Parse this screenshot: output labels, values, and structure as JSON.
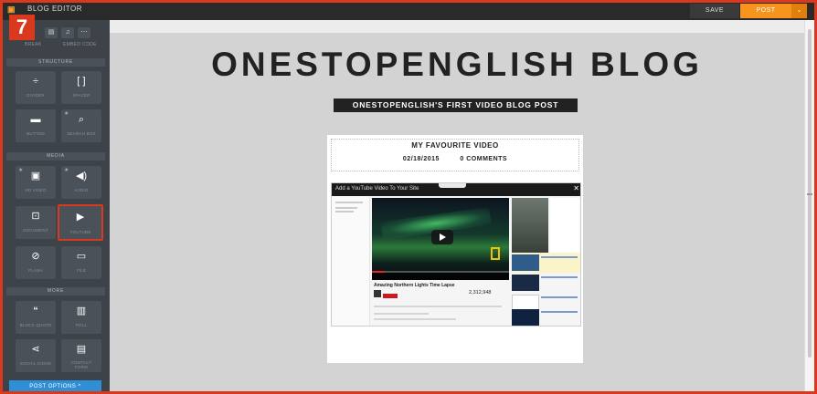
{
  "app": {
    "logo": "▣",
    "title": "BLOG EDITOR"
  },
  "step_badge": "7",
  "toolbar": {
    "save_label": "SAVE",
    "post_label": "POST",
    "post_dropdown": "⌄"
  },
  "sidebar": {
    "top_labels": {
      "left": "BREAK",
      "right": "EMBED CODE"
    },
    "sections": {
      "structure": "STRUCTURE",
      "media": "MEDIA",
      "more": "MORE"
    },
    "tiles": {
      "divider": "DIVIDER",
      "spacer": "SPACER",
      "button": "BUTTON",
      "search_box": "SEARCH BOX",
      "hd_video": "HD VIDEO",
      "audio": "AUDIO",
      "document": "DOCUMENT",
      "youtube": "YOUTUBE",
      "flash": "FLASH",
      "file": "FILE",
      "block_quote": "BLOCK QUOTE",
      "poll": "POLL",
      "social_icons": "SOCIAL ICONS",
      "contact_form": "CONTACT FORM"
    },
    "post_options": "POST OPTIONS  ^"
  },
  "blog": {
    "title": "ONESTOPENGLISH BLOG",
    "subtitle": "ONESTOPENGLISH'S FIRST VIDEO BLOG POST",
    "post_title": "MY FAVOURITE VIDEO",
    "post_date": "02/18/2015",
    "post_comments": "0 COMMENTS"
  },
  "video": {
    "dialog_title": "Add a YouTube Video To Your Site",
    "close": "✕",
    "video_title": "Amazing Northern Lights Time Lapse",
    "views": "2,312,948"
  },
  "colors": {
    "accent_red": "#d9391c",
    "post_orange": "#f7941d",
    "sidebar_bg": "#3e434a",
    "options_blue": "#2e8fd6"
  }
}
